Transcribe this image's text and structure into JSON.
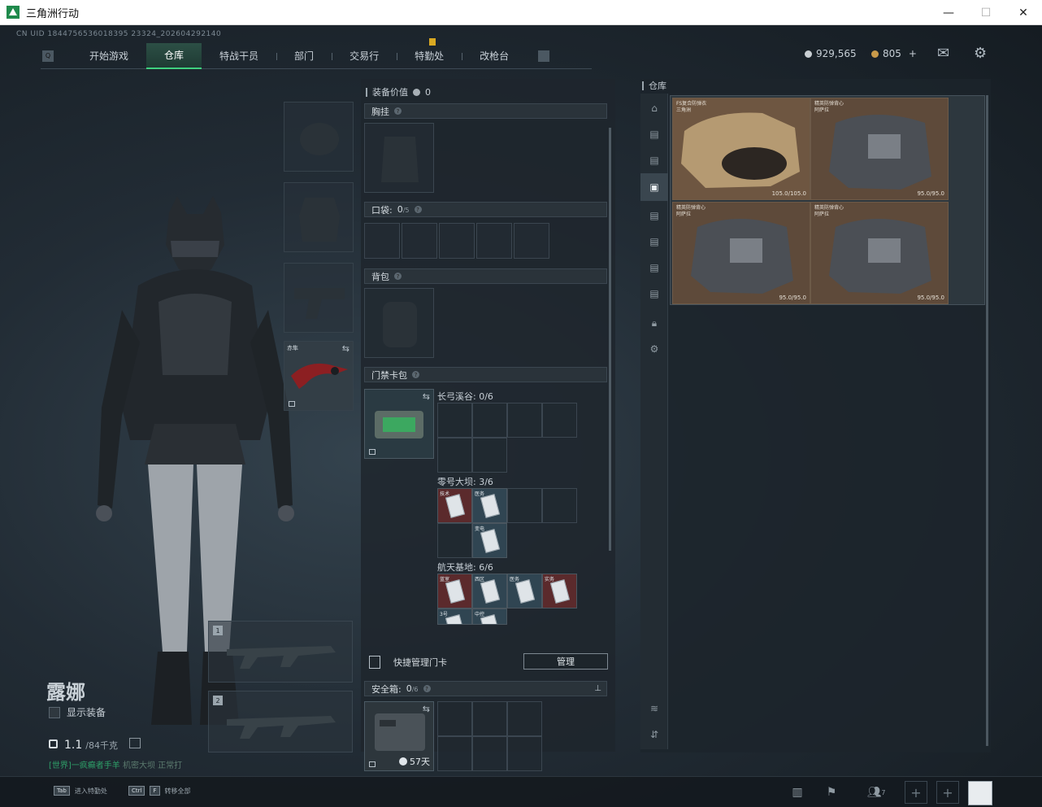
{
  "window": {
    "title": "三角洲行动",
    "controls": [
      "—",
      "☐",
      "✕"
    ]
  },
  "uid": "CN UID 1844756536018395 23324_202604292140",
  "nav": {
    "tabs": [
      {
        "label": "开始游戏"
      },
      {
        "label": "仓库",
        "active": true
      },
      {
        "label": "特战干员"
      },
      {
        "label": "部门"
      },
      {
        "label": "交易行"
      },
      {
        "label": "特勤处",
        "alert": true
      },
      {
        "label": "改枪台"
      }
    ]
  },
  "currency": {
    "silver": "929,565",
    "gold": "805",
    "gold_plus": "+"
  },
  "character": {
    "name": "露娜",
    "show_equipment": "显示装备",
    "weight": "1.1",
    "weight_max": "/84千克"
  },
  "chat": {
    "channel": "[世界]",
    "sender": "一疯癫者手羊",
    "message": "机密大坝 正常打"
  },
  "equip_slots": {
    "melee_label": "赤隼"
  },
  "weapon_slots": [
    "1",
    "2"
  ],
  "middle": {
    "value_label": "装备价值",
    "value": "0",
    "chest_rig": "胸挂",
    "pocket": "口袋:",
    "pocket_count": "0",
    "pocket_max": "/5",
    "backpack": "背包",
    "keycard_bag": "门禁卡包",
    "maps": [
      {
        "title": "长弓溪谷: 0/6"
      },
      {
        "title": "零号大坝: 3/6",
        "cards": [
          {
            "name": "技术",
            "color": "red"
          },
          {
            "name": "医务",
            "color": "blue"
          },
          {
            "name": "变电",
            "color": "blue"
          }
        ]
      },
      {
        "title": "航天基地: 6/6",
        "cards": [
          {
            "name": "蓝室",
            "color": "red"
          },
          {
            "name": "西区",
            "color": "blue"
          },
          {
            "name": "医务",
            "color": "blue"
          },
          {
            "name": "实务",
            "color": "red"
          },
          {
            "name": "3号",
            "color": "blue"
          },
          {
            "name": "中控",
            "color": "blue"
          }
        ]
      }
    ],
    "quick_manage": "快捷管理门卡",
    "manage_btn": "管理",
    "safe_box": "安全箱:",
    "safe_count": "0",
    "safe_max": "/6",
    "safe_days": "57天"
  },
  "warehouse": {
    "title": "仓库",
    "items": [
      {
        "name": "FS复合防弹衣",
        "sub": "三角洲",
        "durability": "105.0/105.0",
        "color": "#7a5e44"
      },
      {
        "name": "精英防弹背心",
        "sub": "阿萨拉",
        "durability": "95.0/95.0",
        "color": "#5e4a3a"
      },
      {
        "name": "精英防弹背心",
        "sub": "阿萨拉",
        "durability": "95.0/95.0",
        "color": "#5e4a3a"
      },
      {
        "name": "精英防弹背心",
        "sub": "阿萨拉",
        "durability": "95.0/95.0",
        "color": "#5e4a3a"
      }
    ]
  },
  "bottom": {
    "hint1_key": "Tab",
    "hint1_label": "进入特勤处",
    "hint2_key1": "Ctrl",
    "hint2_key2": "F",
    "hint2_label": "转移全部",
    "friends_count": "7"
  }
}
